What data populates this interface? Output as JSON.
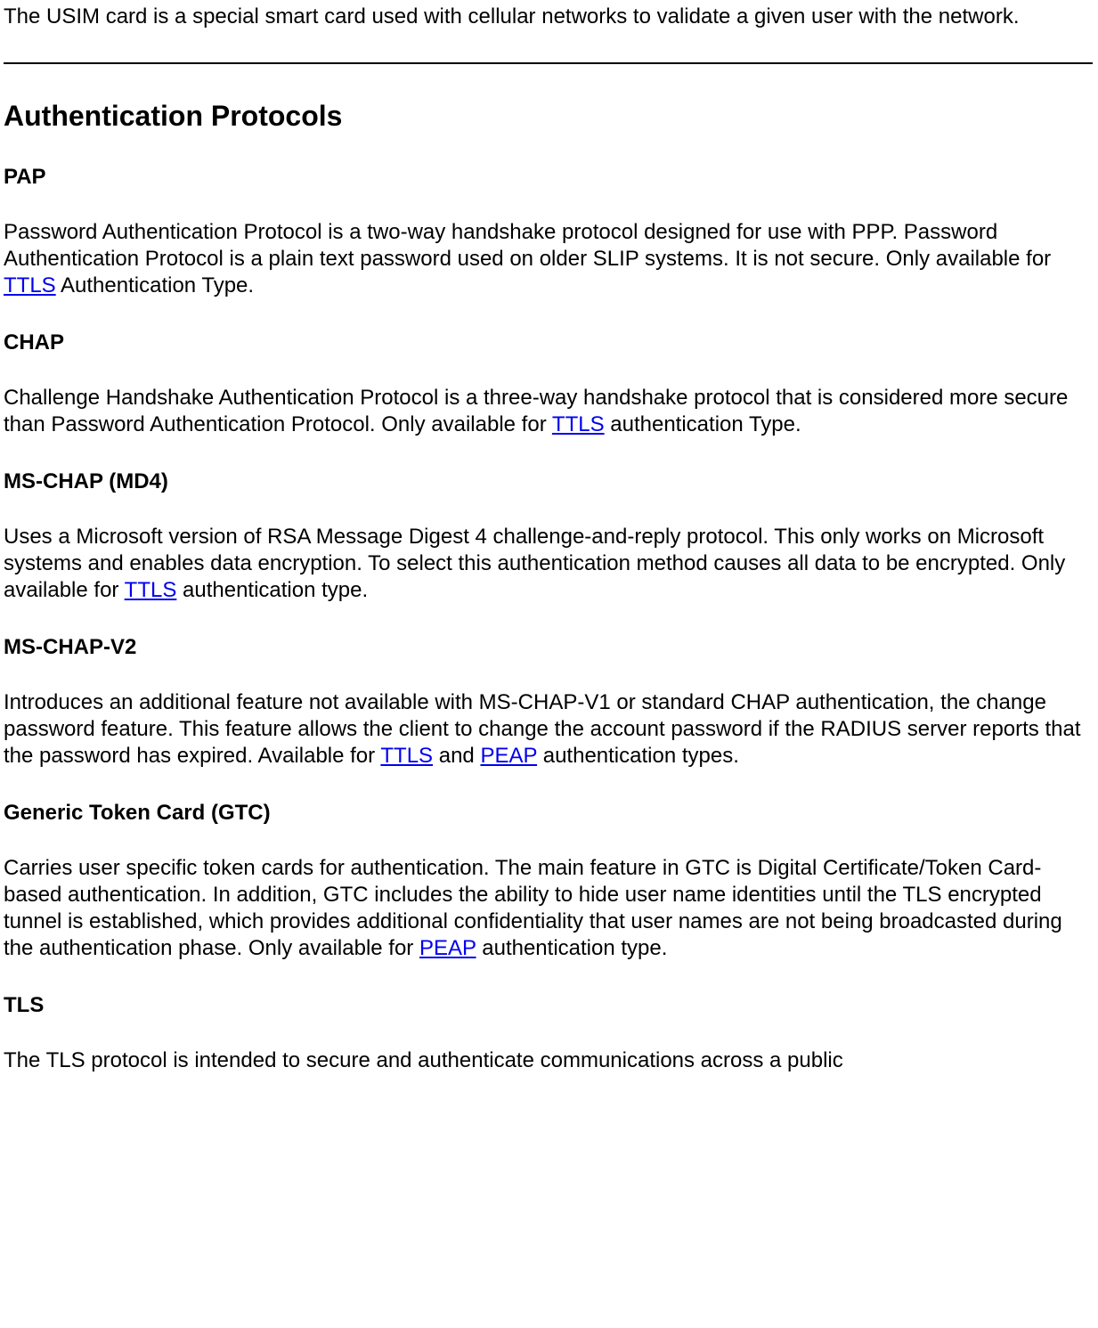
{
  "intro": "The USIM card is a special smart card used with cellular networks to validate a given user with the network.",
  "heading": "Authentication Protocols",
  "link_ttls": "TTLS",
  "link_peap": "PEAP",
  "pap": {
    "title": "PAP",
    "p1": "Password Authentication Protocol is a two-way handshake protocol designed for use with PPP. Password Authentication Protocol is a plain text password used on older SLIP systems. It is not secure. Only available for ",
    "p2": " Authentication Type."
  },
  "chap": {
    "title": "CHAP",
    "p1": "Challenge Handshake Authentication Protocol is a three-way handshake protocol that is considered more secure than Password Authentication Protocol. Only available for ",
    "p2": " authentication Type."
  },
  "mschap_md4": {
    "title": "MS-CHAP (MD4)",
    "p1": "Uses a Microsoft version of RSA Message Digest 4 challenge-and-reply protocol. This only works on Microsoft systems and enables data encryption. To select this authentication method causes all data to be encrypted. Only available for ",
    "p2": " authentication type."
  },
  "mschap_v2": {
    "title": "MS-CHAP-V2",
    "p1": "Introduces an additional feature not available with MS-CHAP-V1 or standard CHAP authentication, the change password feature. This feature allows the client to change the account password if the RADIUS server reports that the password has expired. Available for ",
    "p2": " and ",
    "p3": " authentication types."
  },
  "gtc": {
    "title": "Generic Token Card (GTC)",
    "p1": "Carries user specific token cards for authentication. The main feature in GTC is Digital Certificate/Token Card-based authentication. In addition, GTC includes the ability to hide user name identities until the TLS encrypted tunnel is established, which provides additional confidentiality that user names are not being broadcasted during the authentication phase. Only available for ",
    "p2": " authentication type."
  },
  "tls": {
    "title": "TLS",
    "p1": "The TLS protocol is intended to secure and authenticate communications across a public"
  }
}
